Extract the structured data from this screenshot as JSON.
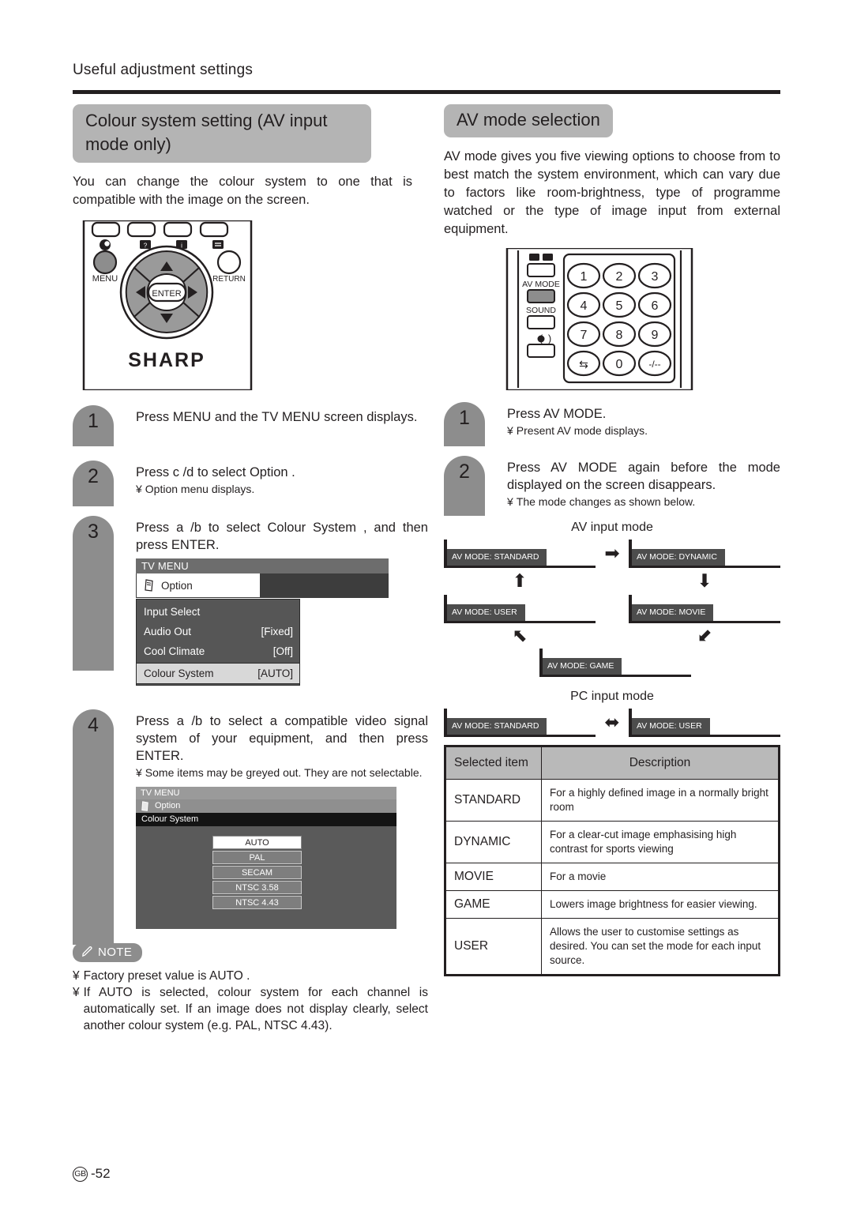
{
  "page": {
    "running_head": "Useful adjustment settings",
    "footer_region": "GB",
    "footer_page": "-52"
  },
  "left": {
    "title": "Colour system setting (AV input mode only)",
    "intro": "You can change the colour system to one that is compatible with the image on the screen.",
    "remote": {
      "menu_label": "MENU",
      "return_label": "RETURN",
      "enter_label": "ENTER",
      "brand": "SHARP"
    },
    "steps": [
      {
        "num": "1",
        "text": "Press MENU and the TV MENU screen displays.",
        "sub": []
      },
      {
        "num": "2",
        "text": "Press c /d  to select  Option .",
        "sub": [
          "Option menu displays."
        ]
      },
      {
        "num": "3",
        "text": "Press a /b  to select  Colour System , and then press ENTER.",
        "sub": []
      },
      {
        "num": "4",
        "text": "Press a /b  to select a compatible video signal system of your equipment, and then press ENTER.",
        "sub": [
          "Some items may be greyed out. They are not selectable."
        ]
      }
    ],
    "osd_option": {
      "title": "TV MENU",
      "tab_label": "Option",
      "rows": [
        {
          "label": "Input Select",
          "value": "",
          "selected": false
        },
        {
          "label": "Audio Out",
          "value": "[Fixed]",
          "selected": false
        },
        {
          "label": "Cool Climate",
          "value": "[Off]",
          "selected": false
        },
        {
          "label": "Colour System",
          "value": "[AUTO]",
          "selected": true
        }
      ]
    },
    "osd_colour": {
      "title": "TV MENU",
      "tab_label": "Option",
      "sub_title": "Colour System",
      "choices": [
        {
          "label": "AUTO",
          "selected": true
        },
        {
          "label": "PAL",
          "selected": false
        },
        {
          "label": "SECAM",
          "selected": false
        },
        {
          "label": "NTSC 3.58",
          "selected": false
        },
        {
          "label": "NTSC 4.43",
          "selected": false
        }
      ]
    },
    "note": {
      "label": "NOTE",
      "items": [
        "Factory preset value is  AUTO .",
        "If  AUTO  is selected, colour system for each channel is automatically set. If an image does not display clearly, select another colour system (e.g. PAL, NTSC 4.43)."
      ]
    }
  },
  "right": {
    "title": "AV mode selection",
    "intro": "AV mode gives you five viewing options to choose from to best match the system environment, which can vary due to factors like room-brightness, type of programme watched or the type of image input from external equipment.",
    "remote": {
      "av_mode_label": "AV MODE",
      "sound_label": "SOUND",
      "keys": [
        "1",
        "2",
        "3",
        "4",
        "5",
        "6",
        "7",
        "8",
        "9",
        "⇆",
        "0",
        "-/--"
      ]
    },
    "steps": [
      {
        "num": "1",
        "text": "Press AV MODE.",
        "sub": [
          "Present AV mode displays."
        ]
      },
      {
        "num": "2",
        "text": "Press AV MODE again before the mode displayed on the screen disappears.",
        "sub": [
          "The mode changes as shown below."
        ]
      }
    ],
    "diagram_av": {
      "caption": "AV input mode",
      "nodes": [
        "AV MODE: STANDARD",
        "AV MODE: DYNAMIC",
        "AV MODE: USER",
        "AV MODE: MOVIE",
        "AV MODE: GAME"
      ]
    },
    "diagram_pc": {
      "caption": "PC input mode",
      "nodes": [
        "AV MODE: STANDARD",
        "AV MODE: USER"
      ]
    },
    "table": {
      "headers": [
        "Selected item",
        "Description"
      ],
      "rows": [
        {
          "item": "STANDARD",
          "desc": "For a highly defined image in a normally bright room"
        },
        {
          "item": "DYNAMIC",
          "desc": "For a clear-cut image emphasising high contrast for sports viewing"
        },
        {
          "item": "MOVIE",
          "desc": "For a movie"
        },
        {
          "item": "GAME",
          "desc": "Lowers image brightness for easier viewing."
        },
        {
          "item": "USER",
          "desc": "Allows the user to customise settings as desired. You can set the mode for each input source."
        }
      ]
    }
  }
}
